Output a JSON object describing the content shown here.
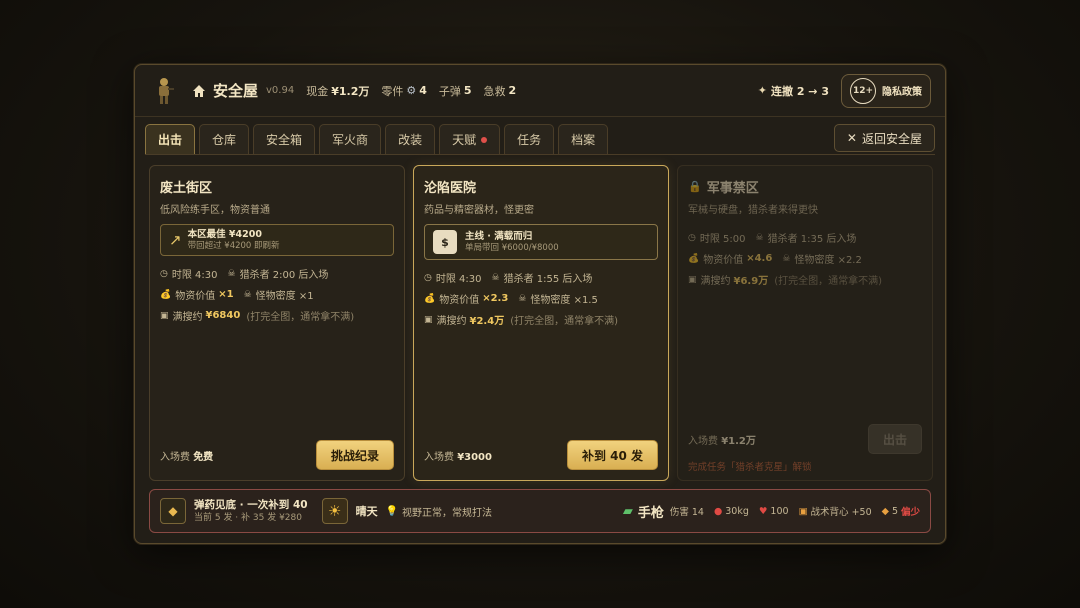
{
  "header": {
    "title": "安全屋",
    "version": "v0.94",
    "cash_label": "现金",
    "cash_value": "¥1.2万",
    "parts_label": "零件",
    "parts_value": "4",
    "bullets_label": "子弹",
    "bullets_value": "5",
    "first_aid_label": "急救",
    "first_aid_value": "2",
    "streak": "连撤 2 → 3",
    "age_rating": "12+",
    "privacy_label": "隐私政策"
  },
  "tabs": [
    {
      "label": "出击",
      "active": true
    },
    {
      "label": "仓库"
    },
    {
      "label": "安全箱"
    },
    {
      "label": "军火商"
    },
    {
      "label": "改装"
    },
    {
      "label": "天赋",
      "dot": true
    },
    {
      "label": "任务"
    },
    {
      "label": "档案"
    }
  ],
  "back_button": "返回安全屋",
  "zones": [
    {
      "name": "废土街区",
      "desc": "低风险练手区，物资普通",
      "best_main": "本区最佳 ¥4200",
      "best_sub": "带回超过 ¥4200 即刷新",
      "time_label": "时限 4:30",
      "hunter_label": "猎杀者 2:00 后入场",
      "value_label": "物资价值",
      "value_mult": "×1",
      "density_label": "怪物密度 ×1",
      "full_label": "满搜约",
      "full_value": "¥6840",
      "full_note": "(打完全图，通常拿不满)",
      "fee_label": "入场费",
      "fee_value": "免费",
      "button": "挑战纪录"
    },
    {
      "name": "沦陷医院",
      "desc": "药品与精密器材，怪更密",
      "mission_main": "主线 · 满载而归",
      "mission_sub": "单局带回 ¥6000/¥8000",
      "time_label": "时限 4:30",
      "hunter_label": "猎杀者 1:55 后入场",
      "value_label": "物资价值",
      "value_mult": "×2.3",
      "density_label": "怪物密度 ×1.5",
      "full_label": "满搜约",
      "full_value": "¥2.4万",
      "full_note": "(打完全图，通常拿不满)",
      "fee_label": "入场费",
      "fee_value": "¥3000",
      "button": "补到 40 发"
    },
    {
      "name": "军事禁区",
      "desc": "军械与硬盘，猎杀者来得更快",
      "time_label": "时限 5:00",
      "hunter_label": "猎杀者 1:35 后入场",
      "value_label": "物资价值",
      "value_mult": "×4.6",
      "density_label": "怪物密度 ×2.2",
      "full_label": "满搜约",
      "full_value": "¥6.9万",
      "full_note": "(打完全图，通常拿不满)",
      "fee_label": "入场费",
      "fee_value": "¥1.2万",
      "button": "出击",
      "lock_hint": "完成任务「猎杀者克星」解锁"
    }
  ],
  "bottom": {
    "ammo_main": "弹药见底 · 一次补到 40",
    "ammo_sub": "当前 5 发 · 补 35 发 ¥280",
    "weather": "晴天",
    "weather_desc": "视野正常，常规打法",
    "weapon": "手枪",
    "damage": "伤害 14",
    "weight": "30kg",
    "health": "100",
    "backpack": "战术背心 +50",
    "bullets": "5",
    "lack": "偏少"
  }
}
